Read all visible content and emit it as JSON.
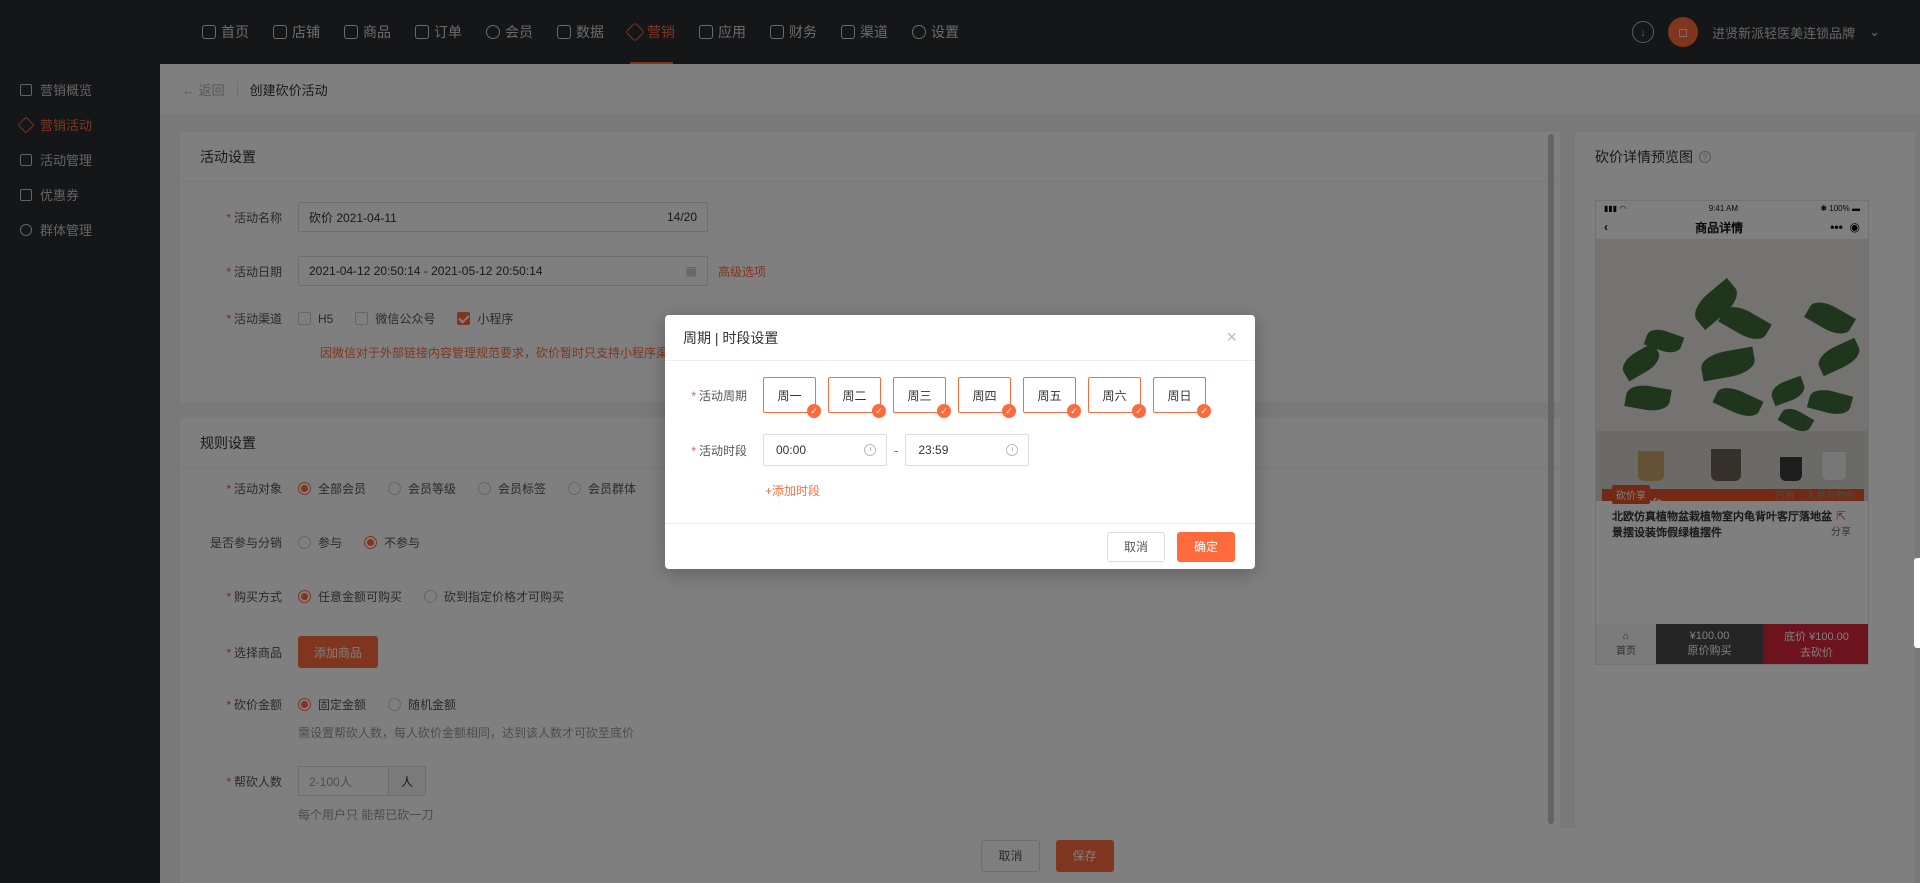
{
  "nav": {
    "items": [
      {
        "label": "首页",
        "icon": "home-icon"
      },
      {
        "label": "店铺",
        "icon": "store-icon"
      },
      {
        "label": "商品",
        "icon": "goods-icon"
      },
      {
        "label": "订单",
        "icon": "order-icon"
      },
      {
        "label": "会员",
        "icon": "member-icon"
      },
      {
        "label": "数据",
        "icon": "chart-icon"
      },
      {
        "label": "营销",
        "icon": "tag-icon"
      },
      {
        "label": "应用",
        "icon": "app-icon"
      },
      {
        "label": "财务",
        "icon": "finance-icon"
      },
      {
        "label": "渠道",
        "icon": "channel-icon"
      },
      {
        "label": "设置",
        "icon": "gear-icon"
      }
    ],
    "active": "营销",
    "shop_name": "进贤新派轻医美连锁品牌",
    "accent": "#ff6a3d"
  },
  "sidebar": {
    "items": [
      {
        "label": "营销概览"
      },
      {
        "label": "营销活动"
      },
      {
        "label": "活动管理"
      },
      {
        "label": "优惠券"
      },
      {
        "label": "群体管理"
      }
    ],
    "active": "营销活动"
  },
  "crumb": {
    "back": "返回",
    "title": "创建砍价活动"
  },
  "activity": {
    "section_title": "活动设置",
    "name_label": "活动名称",
    "name_value": "砍价  2021-04-11",
    "name_count": "14/20",
    "date_label": "活动日期",
    "date_value": "2021-04-12 20:50:14 - 2021-05-12 20:50:14",
    "advanced": "高级选项",
    "channel_label": "活动渠道",
    "channels": [
      {
        "label": "H5",
        "checked": false
      },
      {
        "label": "微信公众号",
        "checked": false
      },
      {
        "label": "小程序",
        "checked": true
      }
    ],
    "channel_warn": "因微信对于外部链接内容管理规范要求，砍价暂时只支持小程序渠"
  },
  "rules": {
    "section_title": "规则设置",
    "target_label": "活动对象",
    "targets": [
      "全部会员",
      "会员等级",
      "会员标签",
      "会员群体"
    ],
    "distribution_label": "是否参与分销",
    "distribution_options": [
      "参与",
      "不参与"
    ],
    "buy_label": "购买方式",
    "buy_options": [
      "任意金额可购买",
      "砍到指定价格才可购买"
    ],
    "goods_label": "选择商品",
    "goods_button": "添加商品",
    "amount_label": "砍价金额",
    "amount_options": [
      "固定金额",
      "随机金额"
    ],
    "amount_hint": "需设置帮砍人数，每人砍价金额相同，达到该人数才可砍至底价",
    "helpers_label": "帮砍人数",
    "helpers_placeholder": "2-100人",
    "helpers_unit": "人",
    "helpers_hint": "每个用户只   能帮已砍一刀"
  },
  "preview": {
    "title": "砍价详情预览图",
    "phone_time": "9:41 AM",
    "phone_battery": "100%",
    "page_title": "商品详情",
    "banner": "全民砍价",
    "tag": "砍价享",
    "price": "¥100.00",
    "joined_prefix": "已有",
    "joined_count": "24",
    "joined_suffix": "人参与砍价",
    "product_name": "北欧仿真植物盆栽植物室内龟背叶客厅落地盆景摆设装饰假绿植摆件",
    "share": "分享",
    "bar_home": "首页",
    "bar_buy_price": "¥100.00",
    "bar_buy_label": "原价购买",
    "bar_cut_price": "底价 ¥100.00",
    "bar_cut_label": "去砍价"
  },
  "footer": {
    "cancel": "取消",
    "save": "保存"
  },
  "modal": {
    "title": "周期 | 时段设置",
    "period_label": "活动周期",
    "days": [
      "周一",
      "周二",
      "周三",
      "周四",
      "周五",
      "周六",
      "周日"
    ],
    "time_label": "活动时段",
    "start_time": "00:00",
    "end_time": "23:59",
    "add_period": "+添加时段",
    "cancel": "取消",
    "confirm": "确定"
  }
}
